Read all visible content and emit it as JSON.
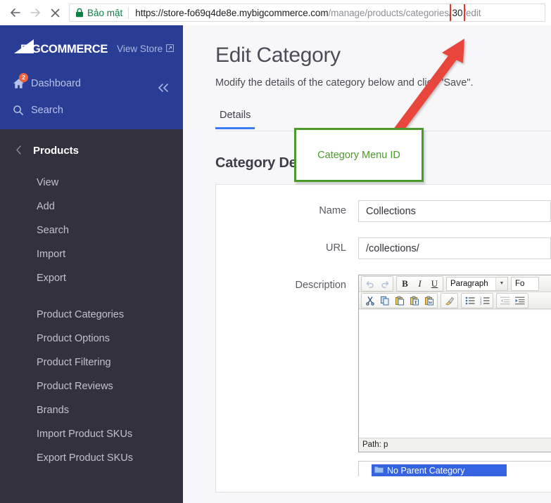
{
  "browser": {
    "back_icon": "arrow-left-icon",
    "forward_icon": "arrow-right-icon",
    "stop_icon": "close-icon",
    "lock_icon": "lock-icon",
    "secure_label": "Bảo mật",
    "url": {
      "scheme": "https://",
      "host": "store-fo69q4de8e.mybigcommerce.com",
      "path_before": "/manage/products/categories/",
      "highlighted_id": "30",
      "path_after": "/edit",
      "full": "https://store-fo69q4de8e.mybigcommerce.com/manage/products/categories/30/edit"
    },
    "highlight_color": "#e8342a"
  },
  "sidebar": {
    "brand": "BIGCOMMERCE",
    "brand_big": "BIG",
    "brand_rest": "COMMERCE",
    "view_store": "View Store",
    "view_store_icon": "external-link-icon",
    "top_links": [
      {
        "label": "Dashboard",
        "icon": "home-icon",
        "badge": "2"
      },
      {
        "label": "Search",
        "icon": "search-icon",
        "badge": ""
      }
    ],
    "collapse_icon": "double-chevron-left-icon",
    "section": {
      "back_icon": "chevron-left-icon",
      "title": "Products",
      "items": [
        {
          "label": "View"
        },
        {
          "label": "Add"
        },
        {
          "label": "Search"
        },
        {
          "label": "Import"
        },
        {
          "label": "Export"
        }
      ],
      "items2": [
        {
          "label": "Product Categories"
        },
        {
          "label": "Product Options"
        },
        {
          "label": "Product Filtering"
        },
        {
          "label": "Product Reviews"
        },
        {
          "label": "Brands"
        },
        {
          "label": "Import Product SKUs"
        },
        {
          "label": "Export Product SKUs"
        }
      ]
    },
    "colors": {
      "top_bg": "#2a3d94",
      "bottom_bg": "#34313f",
      "badge": "#f4623a"
    }
  },
  "main": {
    "title": "Edit Category",
    "subtitle": "Modify the details of the category below and click \"Save\".",
    "tabs": [
      {
        "label": "Details",
        "active": true
      }
    ],
    "section_title": "Category Details",
    "fields": [
      {
        "label": "Name",
        "value": "Collections"
      },
      {
        "label": "URL",
        "value": "/collections/"
      }
    ],
    "description_label": "Description",
    "accent_color": "#3c7cf1"
  },
  "editor": {
    "undo_icon": "undo-icon",
    "redo_icon": "redo-icon",
    "bold": "B",
    "italic": "I",
    "underline": "U",
    "block_format": "Paragraph",
    "font_select": "Fo",
    "caret_icon": "chevron-down-icon",
    "row2_icons": [
      "cut-icon",
      "copy-icon",
      "paste-icon",
      "paste-text-icon",
      "paste-word-icon",
      "remove-format-icon",
      "bullet-list-icon",
      "numbered-list-icon",
      "outdent-icon",
      "indent-icon"
    ],
    "status": "Path: p"
  },
  "parent_category": {
    "label": "No Parent Category",
    "folder_icon": "folder-icon",
    "selected": true,
    "highlight_color": "#3664e0"
  },
  "annotations": {
    "box_text": "Category Menu ID",
    "box_color": "#4c9a2a",
    "arrow_color": "#e8453c",
    "arrow_name": "red-arrow-pointing-to-url-id"
  }
}
